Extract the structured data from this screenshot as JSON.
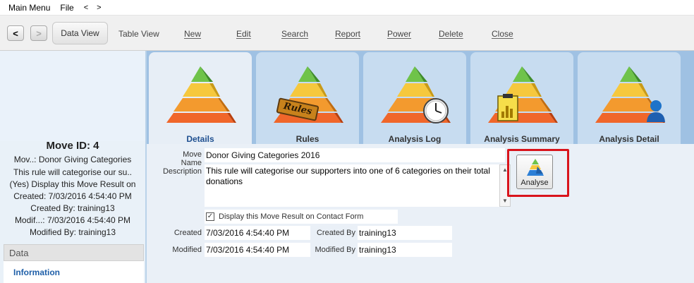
{
  "menu": {
    "main": "Main Menu",
    "file": "File",
    "back": "<",
    "forward": ">"
  },
  "toolbar": {
    "back": "<",
    "forward": ">",
    "data_view": "Data View",
    "table_view": "Table View",
    "new": "New",
    "edit": "Edit",
    "search": "Search",
    "report": "Report",
    "power": "Power",
    "delete": "Delete",
    "close": "Close"
  },
  "summary": {
    "move_id": "Move ID: 4",
    "line1": "Mov..: Donor Giving Categories",
    "line2": "This rule will categorise our su..",
    "line3": "(Yes) Display this Move Result on",
    "line4": "Created: 7/03/2016 4:54:40 PM",
    "line5": "Created By: training13",
    "line6": "Modif...: 7/03/2016 4:54:40 PM",
    "line7": "Modified By: training13"
  },
  "sidebar": {
    "section": "Data",
    "item": "Information"
  },
  "tabs": [
    {
      "label": "Details",
      "badge": "none"
    },
    {
      "label": "Rules",
      "badge": "Rules"
    },
    {
      "label": "Analysis Log",
      "badge": "clock"
    },
    {
      "label": "Analysis Summary",
      "badge": "chart"
    },
    {
      "label": "Analysis Detail",
      "badge": "person"
    }
  ],
  "form": {
    "move_name_label": "Move Name",
    "move_name": "Donor Giving Categories 2016",
    "description_label": "Description",
    "description": "This rule will categorise our supporters into one of 6 categories on their total donations",
    "display_checkbox": "Display this Move Result on Contact Form",
    "created_label": "Created",
    "created": "7/03/2016 4:54:40 PM",
    "created_by_label": "Created By",
    "created_by": "training13",
    "modified_label": "Modified",
    "modified": "7/03/2016 4:54:40 PM",
    "modified_by_label": "Modified By",
    "modified_by": "training13",
    "analyse_button": "Analyse"
  },
  "colors": {
    "highlight": "#d9141c",
    "active_tab_label": "#1e4f90",
    "link": "#1f5fa8"
  }
}
